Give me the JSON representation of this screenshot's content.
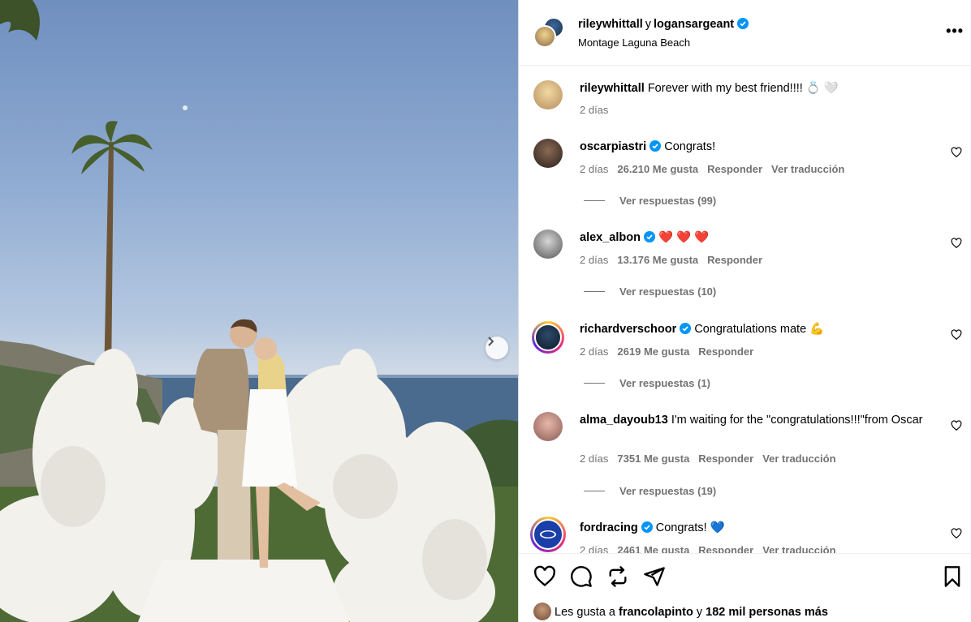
{
  "header": {
    "user1": "rileywhittall",
    "connector": "y",
    "user2": "logansargeant",
    "location": "Montage Laguna Beach",
    "more_label": "•••"
  },
  "caption": {
    "username": "rileywhittall",
    "text": "Forever with my best friend!!!! 💍 🤍",
    "time": "2 días"
  },
  "comments": [
    {
      "username": "oscarpiastri",
      "verified": true,
      "text": "Congrats!",
      "time": "2 días",
      "likes": "26.210 Me gusta",
      "reply": "Responder",
      "translate": "Ver traducción",
      "replies": "Ver respuestas (99)"
    },
    {
      "username": "alex_albon",
      "verified": true,
      "text": "❤️ ❤️ ❤️",
      "time": "2 días",
      "likes": "13.176 Me gusta",
      "reply": "Responder",
      "translate": "",
      "replies": "Ver respuestas (10)"
    },
    {
      "username": "richardverschoor",
      "verified": true,
      "text": "Congratulations mate 💪",
      "time": "2 días",
      "likes": "2619 Me gusta",
      "reply": "Responder",
      "translate": "",
      "replies": "Ver respuestas (1)"
    },
    {
      "username": "alma_dayoub13",
      "verified": false,
      "text": "I'm waiting for the \"congratulations!!!\"from Oscar",
      "time": "2 días",
      "likes": "7351 Me gusta",
      "reply": "Responder",
      "translate": "Ver traducción",
      "replies": "Ver respuestas (19)"
    },
    {
      "username": "fordracing",
      "verified": true,
      "text": "Congrats! 💙",
      "time": "2 días",
      "likes": "2461 Me gusta",
      "reply": "Responder",
      "translate": "Ver traducción",
      "replies": ""
    }
  ],
  "footer": {
    "likes_prefix": "Les gusta a",
    "likes_user": "francolapinto",
    "likes_middle": "y",
    "likes_count": "182 mil personas más"
  },
  "colors": {
    "verified": "#0095f6",
    "muted": "#737373",
    "heart_red": "#e0245e"
  }
}
